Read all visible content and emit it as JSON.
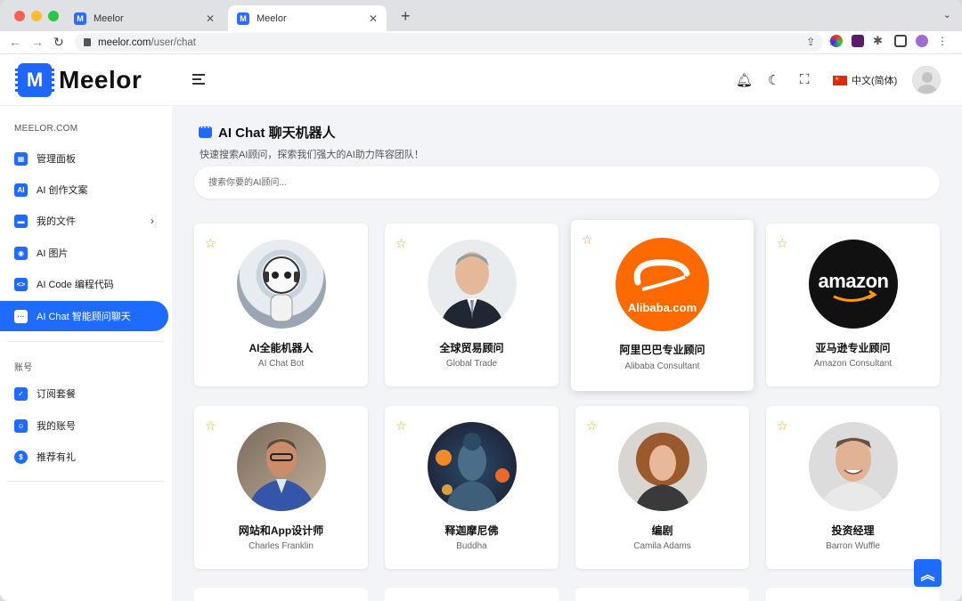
{
  "browser": {
    "tabs": [
      {
        "title": "Meelor",
        "active": false
      },
      {
        "title": "Meelor",
        "active": true
      }
    ],
    "url_host": "meelor.com",
    "url_path": "/user/chat"
  },
  "header": {
    "logo_text": "Meelor",
    "language": "中文(简体)"
  },
  "sidebar": {
    "section1": "MEELOR.COM",
    "items": [
      {
        "label": "管理面板",
        "icon": "dashboard-icon"
      },
      {
        "label": "AI 创作文案",
        "icon": "ai-chip-icon"
      },
      {
        "label": "我的文件",
        "icon": "folder-icon"
      },
      {
        "label": "AI 图片",
        "icon": "image-icon"
      },
      {
        "label": "AI Code 编程代码",
        "icon": "code-icon"
      },
      {
        "label": "AI Chat 智能顾问聊天",
        "icon": "chat-icon"
      }
    ],
    "section2": "账号",
    "account_items": [
      {
        "label": "订阅套餐",
        "icon": "subscription-icon"
      },
      {
        "label": "我的账号",
        "icon": "account-icon"
      },
      {
        "label": "推荐有礼",
        "icon": "referral-icon"
      }
    ]
  },
  "main": {
    "title": "AI Chat 聊天机器人",
    "subtitle": "快速搜索AI顾问，探索我们强大的AI助力阵容团队！",
    "search_placeholder": "搜索你要的AI顾问...",
    "cards": [
      {
        "name": "AI全能机器人",
        "role": "AI Chat Bot"
      },
      {
        "name": "全球贸易顾问",
        "role": "Global Trade"
      },
      {
        "name": "阿里巴巴专业顾问",
        "role": "Alibaba Consultant",
        "logo_text": "Alibaba.com"
      },
      {
        "name": "亚马逊专业顾问",
        "role": "Amazon Consultant",
        "logo_text": "amazon"
      },
      {
        "name": "网站和App设计师",
        "role": "Charles Franklin"
      },
      {
        "name": "释迦摩尼佛",
        "role": "Buddha"
      },
      {
        "name": "编剧",
        "role": "Camila Adams"
      },
      {
        "name": "投资经理",
        "role": "Barron Wuffle"
      }
    ]
  },
  "colors": {
    "accent": "#1f6bff",
    "star": "#f3a21d",
    "background": "#f3f4f8"
  }
}
